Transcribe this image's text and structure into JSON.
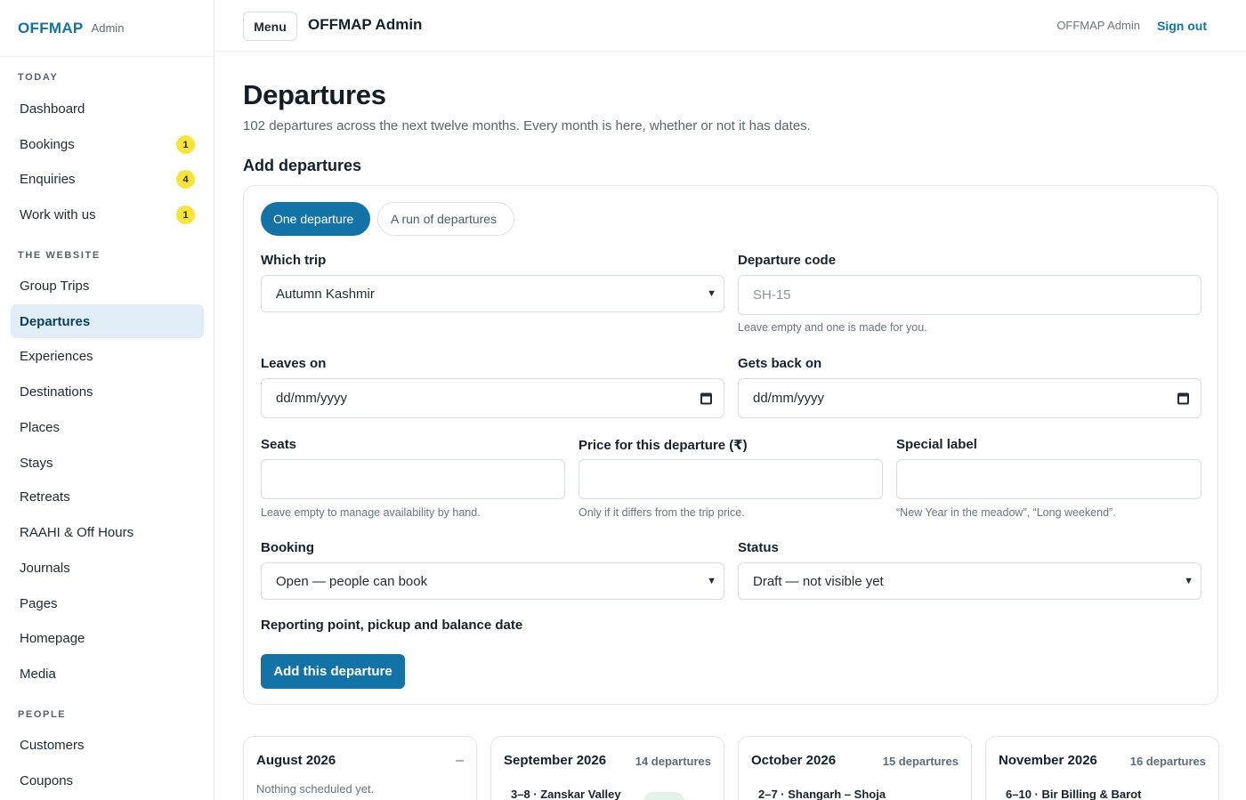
{
  "brand": {
    "logo": "OFFMAP",
    "sub": "Admin"
  },
  "sidebar": {
    "sections": [
      {
        "title": "TODAY",
        "items": [
          {
            "label": "Dashboard"
          },
          {
            "label": "Bookings",
            "badge": "1"
          },
          {
            "label": "Enquiries",
            "badge": "4"
          },
          {
            "label": "Work with us",
            "badge": "1"
          }
        ]
      },
      {
        "title": "THE WEBSITE",
        "items": [
          {
            "label": "Group Trips"
          },
          {
            "label": "Departures",
            "active": true
          },
          {
            "label": "Experiences"
          },
          {
            "label": "Destinations"
          },
          {
            "label": "Places"
          },
          {
            "label": "Stays"
          },
          {
            "label": "Retreats"
          },
          {
            "label": "RAAHI & Off Hours"
          },
          {
            "label": "Journals"
          },
          {
            "label": "Pages"
          },
          {
            "label": "Homepage"
          },
          {
            "label": "Media"
          }
        ]
      },
      {
        "title": "PEOPLE",
        "items": [
          {
            "label": "Customers"
          },
          {
            "label": "Coupons"
          }
        ]
      }
    ]
  },
  "topbar": {
    "menu": "Menu",
    "title": "OFFMAP Admin",
    "user": "OFFMAP Admin",
    "signout": "Sign out"
  },
  "page": {
    "title": "Departures",
    "subtitle": "102 departures across the next twelve months. Every month is here, whether or not it has dates.",
    "section": "Add departures"
  },
  "form": {
    "mode_one": "One departure",
    "mode_run": "A run of departures",
    "trip": {
      "label": "Which trip",
      "value": "Autumn Kashmir"
    },
    "code": {
      "label": "Departure code",
      "placeholder": "SH-15",
      "hint": "Leave empty and one is made for you."
    },
    "leaves": {
      "label": "Leaves on",
      "value": "dd/mm/yyyy"
    },
    "returns": {
      "label": "Gets back on",
      "value": "dd/mm/yyyy"
    },
    "seats": {
      "label": "Seats",
      "hint": "Leave empty to manage availability by hand."
    },
    "price": {
      "label": "Price for this departure (₹)",
      "hint": "Only if it differs from the trip price."
    },
    "special": {
      "label": "Special label",
      "hint": "“New Year in the meadow”, “Long weekend”."
    },
    "booking": {
      "label": "Booking",
      "value": "Open — people can book"
    },
    "status": {
      "label": "Status",
      "value": "Draft — not visible yet"
    },
    "reporting": "Reporting point, pickup and balance date",
    "submit": "Add this departure"
  },
  "months": [
    {
      "title": "August 2026",
      "empty": "Nothing scheduled yet.",
      "collapse": "–"
    },
    {
      "title": "September 2026",
      "count": "14 departures",
      "first": "3–8 · Zanskar Valley"
    },
    {
      "title": "October 2026",
      "count": "15 departures",
      "first": "2–7 · Shangarh – Shoja"
    },
    {
      "title": "November 2026",
      "count": "16 departures",
      "first": "6–10 · Bir Billing & Barot"
    }
  ]
}
